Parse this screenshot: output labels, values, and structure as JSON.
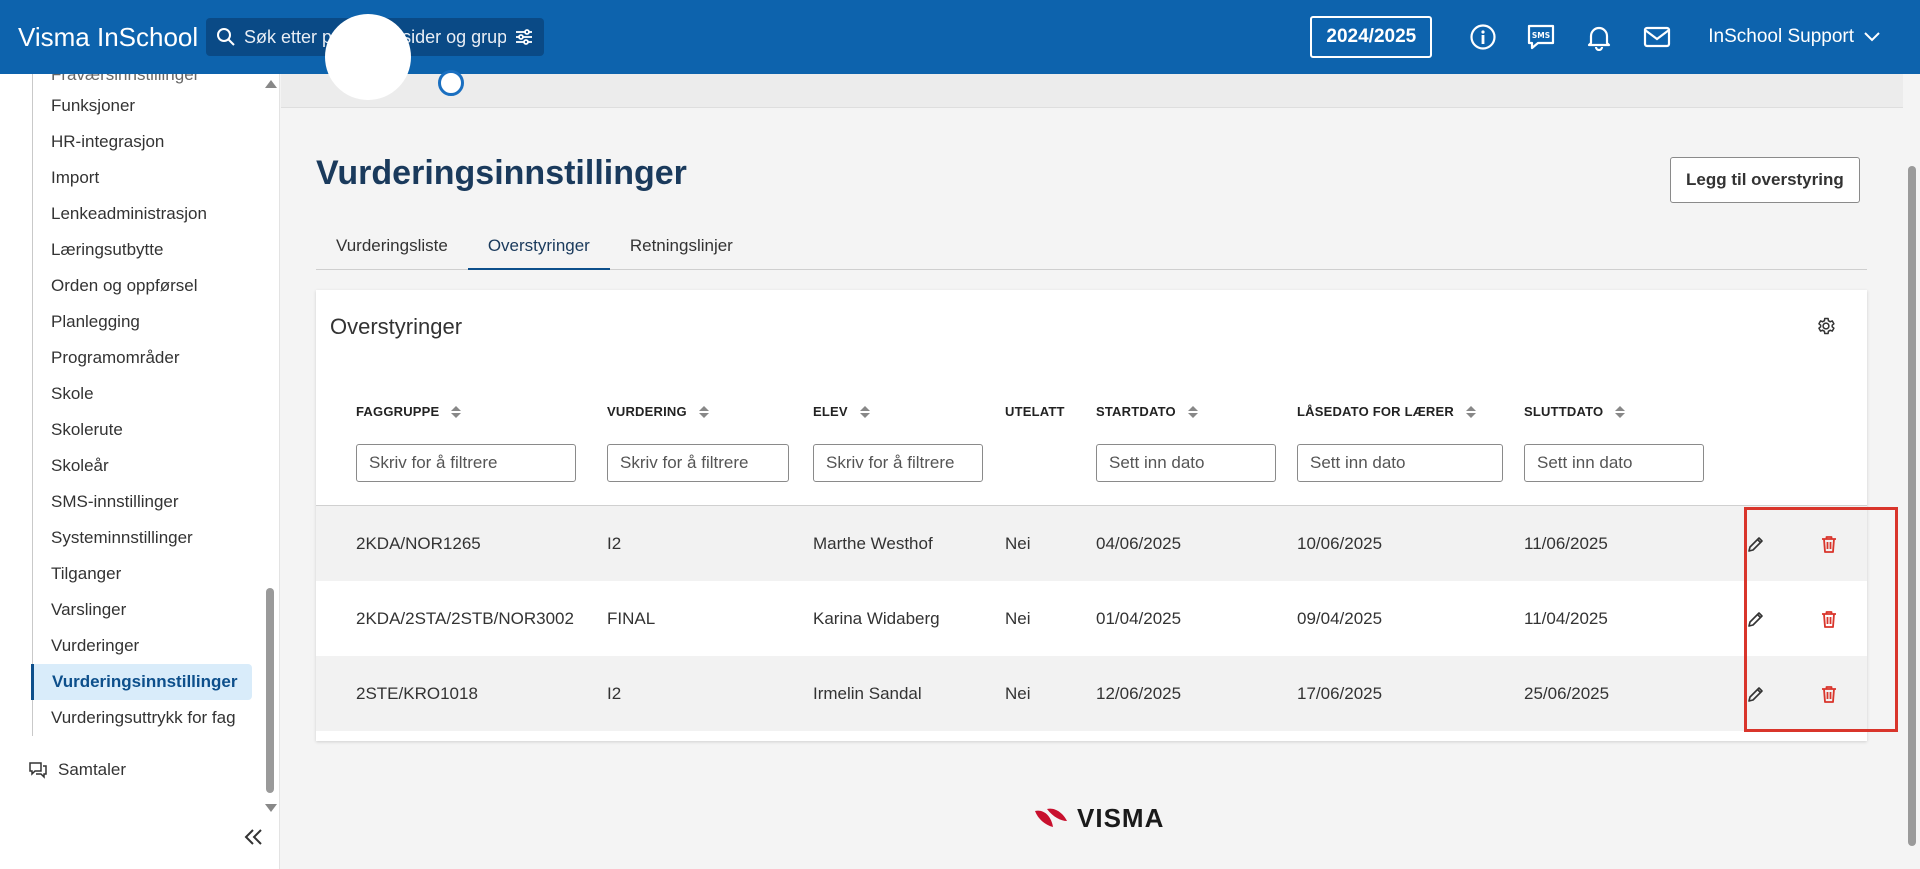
{
  "header": {
    "brand": "Visma InSchool",
    "search_placeholder": "Søk etter personer, sider og grupper",
    "year": "2024/2025",
    "user": "InSchool Support"
  },
  "sidebar": {
    "items": [
      {
        "label": "Fraværsinnstillinger"
      },
      {
        "label": "Funksjoner"
      },
      {
        "label": "HR-integrasjon"
      },
      {
        "label": "Import"
      },
      {
        "label": "Lenkeadministrasjon"
      },
      {
        "label": "Læringsutbytte"
      },
      {
        "label": "Orden og oppførsel"
      },
      {
        "label": "Planlegging"
      },
      {
        "label": "Programområder"
      },
      {
        "label": "Skole"
      },
      {
        "label": "Skolerute"
      },
      {
        "label": "Skoleår"
      },
      {
        "label": "SMS-innstillinger"
      },
      {
        "label": "Systeminnstillinger"
      },
      {
        "label": "Tilganger"
      },
      {
        "label": "Varslinger"
      },
      {
        "label": "Vurderinger"
      },
      {
        "label": "Vurderingsinnstillinger"
      },
      {
        "label": "Vurderingsuttrykk for fag"
      }
    ],
    "active_index": 17,
    "samtaler": "Samtaler"
  },
  "main": {
    "title": "Vurderingsinnstillinger",
    "add_button": "Legg til overstyring",
    "tabs": [
      {
        "label": "Vurderingsliste"
      },
      {
        "label": "Overstyringer"
      },
      {
        "label": "Retningslinjer"
      }
    ],
    "active_tab": 1,
    "card_title": "Overstyringer",
    "columns": [
      {
        "label": "FAGGRUPPE",
        "filter": "Skriv for å filtrere"
      },
      {
        "label": "VURDERING",
        "filter": "Skriv for å filtrere"
      },
      {
        "label": "ELEV",
        "filter": "Skriv for å filtrere"
      },
      {
        "label": "UTELATT"
      },
      {
        "label": "STARTDATO",
        "filter": "Sett inn dato"
      },
      {
        "label": "LÅSEDATO FOR LÆRER",
        "filter": "Sett inn dato"
      },
      {
        "label": "SLUTTDATO",
        "filter": "Sett inn dato"
      }
    ],
    "rows": [
      {
        "faggruppe": "2KDA/NOR1265",
        "vurdering": "I2",
        "elev": "Marthe Westhof",
        "utelatt": "Nei",
        "start": "04/06/2025",
        "laase": "10/06/2025",
        "slutt": "11/06/2025"
      },
      {
        "faggruppe": "2KDA/2STA/2STB/NOR3002",
        "vurdering": "FINAL",
        "elev": "Karina Widaberg",
        "utelatt": "Nei",
        "start": "01/04/2025",
        "laase": "09/04/2025",
        "slutt": "11/04/2025"
      },
      {
        "faggruppe": "2STE/KRO1018",
        "vurdering": "I2",
        "elev": "Irmelin Sandal",
        "utelatt": "Nei",
        "start": "12/06/2025",
        "laase": "17/06/2025",
        "slutt": "25/06/2025"
      }
    ]
  },
  "footer": {
    "logo": "VISMA"
  },
  "colors": {
    "topbar": "#0d63ad",
    "accent": "#0d4f8b",
    "delete": "#d9352b",
    "highlight": "#d9352b"
  }
}
